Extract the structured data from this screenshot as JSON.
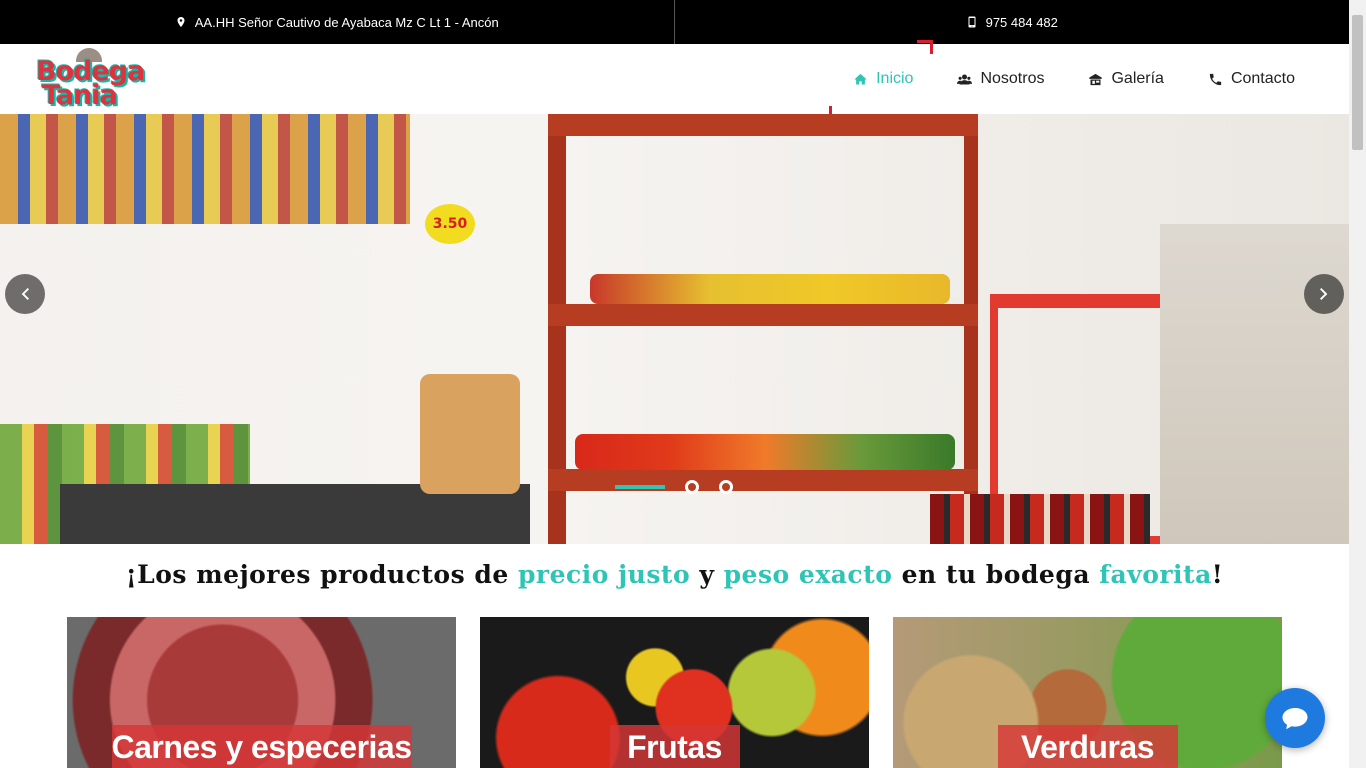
{
  "topbar": {
    "address": "AA.HH Señor Cautivo de Ayabaca Mz C Lt 1 - Ancón",
    "address_icon": "map-marker-icon",
    "phone": "975 484 482",
    "phone_icon": "mobile-phone-icon"
  },
  "logo": {
    "line1": "Bodega",
    "line2": "Tania"
  },
  "nav": {
    "items": [
      {
        "label": "Inicio",
        "icon": "home-icon",
        "active": true
      },
      {
        "label": "Nosotros",
        "icon": "users-icon",
        "active": false
      },
      {
        "label": "Galería",
        "icon": "store-icon",
        "active": false
      },
      {
        "label": "Contacto",
        "icon": "phone-icon",
        "active": false
      }
    ]
  },
  "hero": {
    "price_sign": "3.50",
    "slides_count": 3,
    "active_slide": 1
  },
  "tagline": {
    "part1": "¡Los mejores productos de ",
    "hl1": "precio justo",
    "part2": " y ",
    "hl2": "peso exacto",
    "part3": " en tu bodega ",
    "hl3": "favorita",
    "part4": "!"
  },
  "categories": [
    {
      "label": "Carnes y especerias"
    },
    {
      "label": "Frutas"
    },
    {
      "label": "Verduras"
    }
  ],
  "colors": {
    "accent": "#2ec4b6",
    "brand_red": "#d6202f",
    "topbar_bg": "#000000",
    "chat_blue": "#1f7ae0"
  }
}
